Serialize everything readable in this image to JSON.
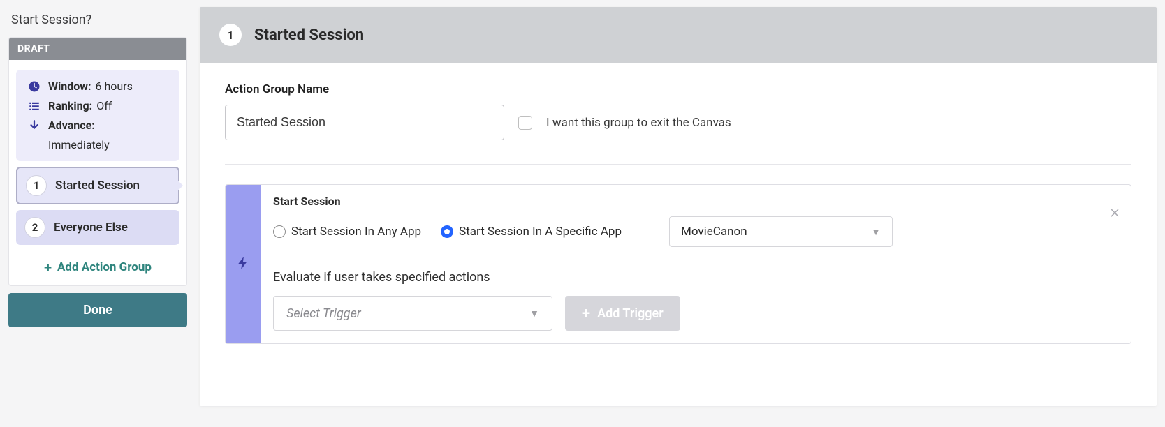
{
  "sidebar": {
    "title": "Start Session?",
    "status_badge": "DRAFT",
    "settings": {
      "window_label": "Window:",
      "window_value": "6 hours",
      "ranking_label": "Ranking:",
      "ranking_value": "Off",
      "advance_label": "Advance:",
      "advance_value": "Immediately"
    },
    "items": [
      {
        "num": "1",
        "label": "Started Session",
        "selected": true
      },
      {
        "num": "2",
        "label": "Everyone Else",
        "selected": false
      }
    ],
    "add_action_group": "Add Action Group",
    "done": "Done"
  },
  "main": {
    "header_num": "1",
    "header_title": "Started Session",
    "group_name_label": "Action Group Name",
    "group_name_value": "Started Session",
    "exit_checkbox_label": "I want this group to exit the Canvas",
    "trigger_card": {
      "title": "Start Session",
      "radio_any": "Start Session In Any App",
      "radio_specific": "Start Session In A Specific App",
      "app_selected": "MovieCanon",
      "evaluate_text": "Evaluate if user takes specified actions",
      "select_trigger_placeholder": "Select Trigger",
      "add_trigger": "Add Trigger"
    }
  }
}
